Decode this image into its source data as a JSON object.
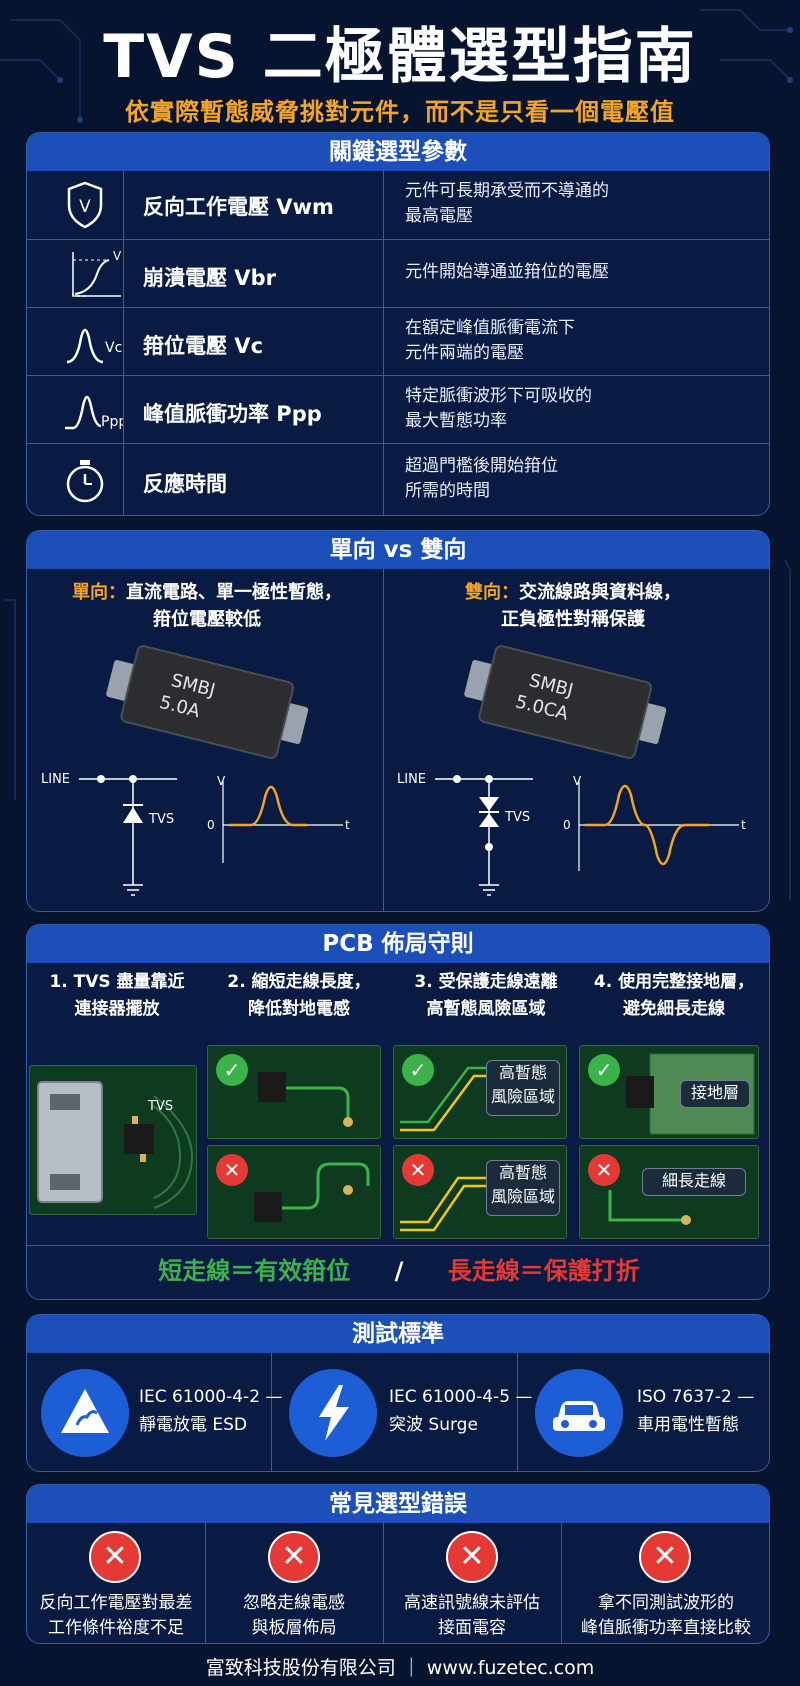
{
  "header": {
    "title": "TVS 二極體選型指南",
    "subtitle": "依實際暫態威脅挑對元件，而不是只看一個電壓值"
  },
  "parameters": {
    "heading": "關鍵選型參數",
    "rows": [
      {
        "icon": "shield-v-icon",
        "icon_text": "V",
        "name": "反向工作電壓 Vwm",
        "desc1": "元件可長期承受而不導通的",
        "desc2": "最高電壓"
      },
      {
        "icon": "breakdown-curve-icon",
        "icon_text": "V",
        "name": "崩潰電壓 Vbr",
        "desc1": "元件開始導通並箝位的電壓",
        "desc2": ""
      },
      {
        "icon": "clamp-pulse-icon",
        "icon_text": "Vc",
        "name": "箝位電壓 Vc",
        "desc1": "在額定峰值脈衝電流下",
        "desc2": "元件兩端的電壓"
      },
      {
        "icon": "peak-pulse-icon",
        "icon_text": "Ppp",
        "name": "峰值脈衝功率 Ppp",
        "desc1": "特定脈衝波形下可吸收的",
        "desc2": "最大暫態功率"
      },
      {
        "icon": "stopwatch-icon",
        "icon_text": "",
        "name": "反應時間",
        "desc1": "超過門檻後開始箝位",
        "desc2": "所需的時間"
      }
    ]
  },
  "direction": {
    "heading": "單向 vs 雙向",
    "uni": {
      "label": "單向：",
      "text1": "直流電路、單一極性暫態，",
      "text2": "箝位電壓較低",
      "chip1": "SMBJ",
      "chip2": "5.0A"
    },
    "bi": {
      "label": "雙向：",
      "text1": "交流線路與資料線，",
      "text2": "正負極性對稱保護",
      "chip1": "SMBJ",
      "chip2": "5.0CA"
    },
    "circuit": {
      "line": "LINE",
      "tvs": "TVS",
      "v": "V",
      "zero": "0",
      "t": "t"
    }
  },
  "pcb": {
    "heading": "PCB 佈局守則",
    "rules": [
      {
        "l1": "1. TVS 盡量靠近",
        "l2": "連接器擺放"
      },
      {
        "l1": "2. 縮短走線長度，",
        "l2": "降低對地電感"
      },
      {
        "l1": "3. 受保護走線遠離",
        "l2": "高暫態風險區域"
      },
      {
        "l1": "4. 使用完整接地層，",
        "l2": "避免細長走線"
      }
    ],
    "tvs_tag": "TVS",
    "risk_zone_1": "高暫態",
    "risk_zone_2": "風險區域",
    "ground_plane": "接地層",
    "thin_trace": "細長走線",
    "ok_mark": "✓",
    "bad_mark": "✕",
    "summary_good": "短走線＝有效箝位",
    "summary_sep": "/",
    "summary_bad": "長走線＝保護打折",
    "colors": {
      "good": "#3bb34a",
      "bad": "#e53935"
    }
  },
  "standards": {
    "heading": "測試標準",
    "items": [
      {
        "icon": "esd-warning-icon",
        "l1": "IEC 61000-4-2 —",
        "l2": "靜電放電 ESD"
      },
      {
        "icon": "lightning-icon",
        "l1": "IEC 61000-4-5 —",
        "l2": "突波 Surge"
      },
      {
        "icon": "car-icon",
        "l1": "ISO 7637-2 —",
        "l2": "車用電性暫態"
      }
    ]
  },
  "mistakes": {
    "heading": "常見選型錯誤",
    "mark": "✕",
    "items": [
      {
        "l1": "反向工作電壓對最差",
        "l2": "工作條件裕度不足"
      },
      {
        "l1": "忽略走線電感",
        "l2": "與板層佈局"
      },
      {
        "l1": "高速訊號線未評估",
        "l2": "接面電容"
      },
      {
        "l1": "拿不同測試波形的",
        "l2": "峰值脈衝功率直接比較"
      }
    ]
  },
  "footer": {
    "text": "富致科技股份有限公司 ｜ www.fuzetec.com"
  },
  "theme": {
    "bg": "#071430",
    "accent": "#f5a524",
    "header_blue": "#1d4fb8"
  }
}
